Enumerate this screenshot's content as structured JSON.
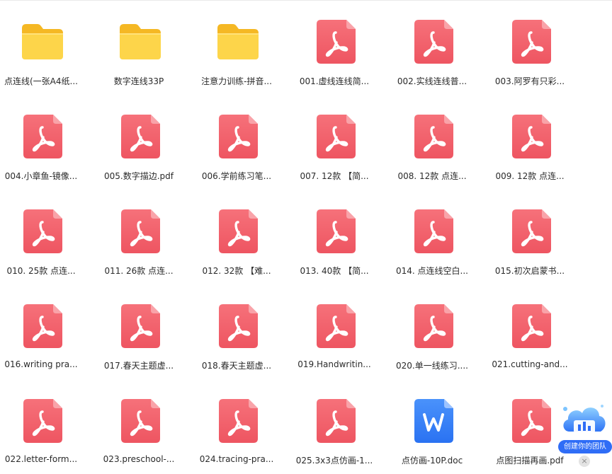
{
  "files": [
    {
      "name": "点连线(一张A4纸...",
      "type": "folder"
    },
    {
      "name": "数字连线33P",
      "type": "folder"
    },
    {
      "name": "注意力训练-拼音...",
      "type": "folder"
    },
    {
      "name": "001.虚线连线简...",
      "type": "pdf"
    },
    {
      "name": "002.实线连线普...",
      "type": "pdf"
    },
    {
      "name": "003.阿罗有只彩...",
      "type": "pdf"
    },
    {
      "name": "004.小章鱼-镜像...",
      "type": "pdf"
    },
    {
      "name": "005.数字描边.pdf",
      "type": "pdf"
    },
    {
      "name": "006.学前练习笔...",
      "type": "pdf"
    },
    {
      "name": "007. 12款  【简...",
      "type": "pdf"
    },
    {
      "name": "008. 12款  点连...",
      "type": "pdf"
    },
    {
      "name": "009. 12款  点连...",
      "type": "pdf"
    },
    {
      "name": "010. 25款 点连...",
      "type": "pdf"
    },
    {
      "name": "011. 26款 点连...",
      "type": "pdf"
    },
    {
      "name": "012. 32款 【难...",
      "type": "pdf"
    },
    {
      "name": "013. 40款  【简...",
      "type": "pdf"
    },
    {
      "name": "014. 点连线空白...",
      "type": "pdf"
    },
    {
      "name": "015.初次启蒙书...",
      "type": "pdf"
    },
    {
      "name": "016.writing pra...",
      "type": "pdf"
    },
    {
      "name": "017.春天主题虚...",
      "type": "pdf"
    },
    {
      "name": "018.春天主题虚...",
      "type": "pdf"
    },
    {
      "name": "019.Handwritin...",
      "type": "pdf"
    },
    {
      "name": "020.单一线练习....",
      "type": "pdf"
    },
    {
      "name": "021.cutting-and...",
      "type": "pdf"
    },
    {
      "name": "022.letter-form...",
      "type": "pdf"
    },
    {
      "name": "023.preschool-...",
      "type": "pdf"
    },
    {
      "name": "024.tracing-pra...",
      "type": "pdf"
    },
    {
      "name": "025.3x3点仿画-1...",
      "type": "pdf"
    },
    {
      "name": "点仿画-10P.doc",
      "type": "doc"
    },
    {
      "name": "点图扫描再画.pdf",
      "type": "pdf"
    }
  ],
  "icons": {
    "folder": "folder-icon",
    "pdf": "pdf-file-icon",
    "doc": "word-doc-icon"
  },
  "colors": {
    "pdf": "#f15c66",
    "doc": "#2f7cf6",
    "folder": "#fbc531",
    "badge": "#2f6df6"
  },
  "team_badge": {
    "label": "创建你的团队",
    "close": "×"
  }
}
